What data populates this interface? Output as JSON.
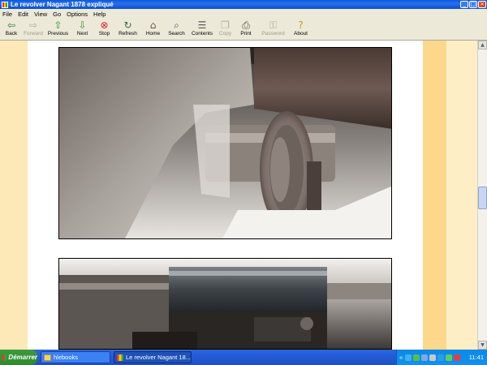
{
  "window": {
    "title": "Le revolver Nagant 1878 expliqué"
  },
  "menu": [
    "File",
    "Edit",
    "View",
    "Go",
    "Options",
    "Help"
  ],
  "toolbar": [
    {
      "label": "Back",
      "icon": "back-arrow-icon",
      "glyph": "⇦",
      "color": "#2e7d32",
      "enabled": true
    },
    {
      "label": "Forward",
      "icon": "forward-arrow-icon",
      "glyph": "⇨",
      "color": "#9c9a8e",
      "enabled": false
    },
    {
      "label": "Previous",
      "icon": "up-arrow-icon",
      "glyph": "⇧",
      "color": "#2e9b2e",
      "enabled": true
    },
    {
      "label": "Next",
      "icon": "down-arrow-icon",
      "glyph": "⇩",
      "color": "#2e9b2e",
      "enabled": true
    },
    {
      "label": "Stop",
      "icon": "stop-icon",
      "glyph": "⊗",
      "color": "#d42020",
      "enabled": true
    },
    {
      "label": "Refresh",
      "icon": "refresh-icon",
      "glyph": "↻",
      "color": "#3a6b3a",
      "enabled": true
    },
    {
      "label": "Home",
      "icon": "home-icon",
      "glyph": "⌂",
      "color": "#6b5a3a",
      "enabled": true
    },
    {
      "label": "Search",
      "icon": "search-icon",
      "glyph": "⌕",
      "color": "#3a4f7a",
      "enabled": true
    },
    {
      "label": "Contents",
      "icon": "contents-icon",
      "glyph": "☰",
      "color": "#5a5a5a",
      "enabled": true
    },
    {
      "label": "Copy",
      "icon": "copy-icon",
      "glyph": "❐",
      "color": "#9c9a8e",
      "enabled": false
    },
    {
      "label": "Print",
      "icon": "print-icon",
      "glyph": "⎙",
      "color": "#4a4a4a",
      "enabled": true
    },
    {
      "label": "Password",
      "icon": "key-icon",
      "glyph": "⚿",
      "color": "#9c9a8e",
      "enabled": false
    },
    {
      "label": "About",
      "icon": "about-icon",
      "glyph": "?",
      "color": "#b8a018",
      "enabled": true
    }
  ],
  "taskbar": {
    "start_label": "Démarrer",
    "tasks": [
      {
        "label": "hlebooks",
        "active": false
      },
      {
        "label": "Le revolver Nagant 18...",
        "active": true
      }
    ],
    "tray_prefix": "«",
    "clock": "11:41"
  },
  "colors": {
    "page_bg": "#ffffff",
    "side_bg": "#fde9b7",
    "accent_stripe": "#fcd98a"
  }
}
